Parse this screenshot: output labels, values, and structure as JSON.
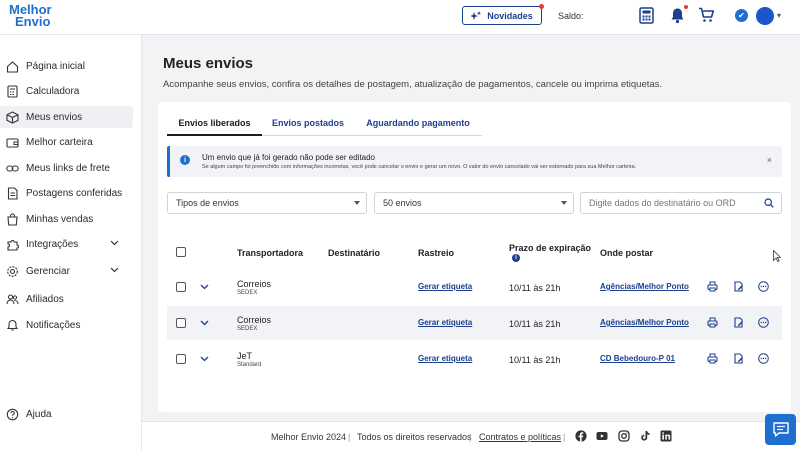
{
  "brand": {
    "line1": "Melhor",
    "line2": "Envio",
    "color": "#1f6fd1"
  },
  "header": {
    "novidades": "Novidades",
    "saldo": "Saldo:"
  },
  "sidebar": {
    "items": [
      {
        "label": "Página inicial",
        "icon": "home-icon"
      },
      {
        "label": "Calculadora",
        "icon": "calculator-icon"
      },
      {
        "label": "Meus envios",
        "icon": "box-icon",
        "active": true
      },
      {
        "label": "Melhor carteira",
        "icon": "wallet-icon"
      },
      {
        "label": "Meus links de frete",
        "icon": "link-icon"
      },
      {
        "label": "Postagens conferidas",
        "icon": "document-icon"
      },
      {
        "label": "Minhas vendas",
        "icon": "shopping-bag-icon"
      },
      {
        "label": "Integrações",
        "icon": "puzzle-icon",
        "expandable": true
      },
      {
        "label": "Gerenciar",
        "icon": "gear-icon",
        "expandable": true
      },
      {
        "label": "Afiliados",
        "icon": "users-icon"
      },
      {
        "label": "Notificações",
        "icon": "bell-icon"
      }
    ],
    "help": "Ajuda"
  },
  "main": {
    "title": "Meus envios",
    "subtitle": "Acompanhe seus envios, confira os detalhes de postagem, atualização de pagamentos, cancele ou imprima etiquetas.",
    "tabs": [
      "Envios liberados",
      "Envios postados",
      "Aguardando pagamento"
    ],
    "alert": {
      "title": "Um envio que já foi gerado não pode ser editado",
      "detail": "Se algum campo foi preenchido com informações incorretas, você pode cancelar o envio e gerar um novo. O valor do envio cancelado vai ser estornado para sua Melhor carteira."
    },
    "filters": {
      "type": "Tipos de envios",
      "count": "50 envios",
      "search_placeholder": "Digite dados do destinatário ou ORD"
    },
    "columns": {
      "carrier": "Transportadora",
      "recipient": "Destinatário",
      "tracking": "Rastreio",
      "expiry": "Prazo de expiração",
      "where": "Onde postar"
    },
    "rows": [
      {
        "carrier": "Correios",
        "service": "SEDEX",
        "tracking": "Gerar etiqueta",
        "expiry": "10/11 às 21h",
        "where": "Agências/Melhor Ponto"
      },
      {
        "carrier": "Correios",
        "service": "SEDEX",
        "tracking": "Gerar etiqueta",
        "expiry": "10/11 às 21h",
        "where": "Agências/Melhor Ponto"
      },
      {
        "carrier": "JeT",
        "service": "Standard",
        "tracking": "Gerar etiqueta",
        "expiry": "10/11 às 21h",
        "where": "CD Bebedouro-P 01"
      }
    ]
  },
  "footer": {
    "brand": "Melhor Envio 2024",
    "rights": "Todos os direitos reservados",
    "terms": "Contratos e políticas",
    "sep": "|"
  }
}
